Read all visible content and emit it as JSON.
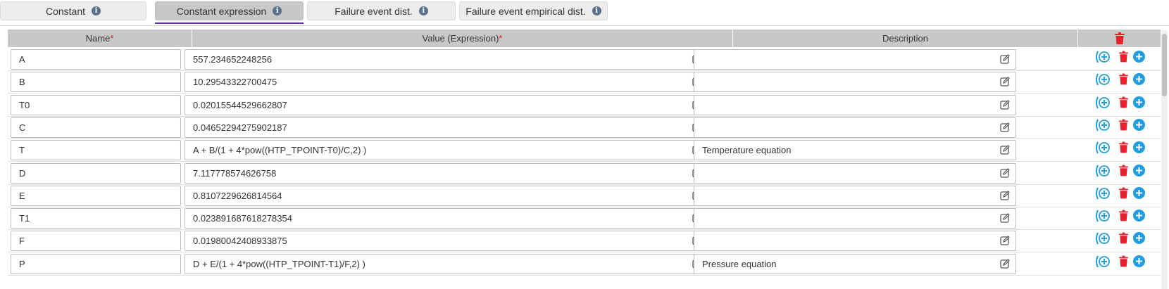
{
  "tabs": [
    {
      "label": "Constant",
      "active": false
    },
    {
      "label": "Constant expression",
      "active": true
    },
    {
      "label": "Failure event dist.",
      "active": false
    },
    {
      "label": "Failure event empirical dist.",
      "active": false
    }
  ],
  "table": {
    "headers": {
      "name": "Name",
      "value": "Value (Expression)",
      "description": "Description",
      "required_mark": "*"
    },
    "rows": [
      {
        "name": "A",
        "value": "557.234652248256",
        "description": ""
      },
      {
        "name": "B",
        "value": "10.29543322700475",
        "description": ""
      },
      {
        "name": "T0",
        "value": "0.02015544529662807",
        "description": ""
      },
      {
        "name": "C",
        "value": "0.04652294275902187",
        "description": ""
      },
      {
        "name": "T",
        "value": "A + B/(1 + 4*pow((HTP_TPOINT-T0)/C,2) )",
        "description": "Temperature equation"
      },
      {
        "name": "D",
        "value": "7.117778574626758",
        "description": ""
      },
      {
        "name": "E",
        "value": "0.8107229626814564",
        "description": ""
      },
      {
        "name": "T1",
        "value": "0.023891687618278354",
        "description": ""
      },
      {
        "name": "F",
        "value": "0.01980042408933875",
        "description": ""
      },
      {
        "name": "P",
        "value": "D + E/(1 + 4*pow((HTP_TPOINT-T1)/F,2) )",
        "description": "Pressure equation"
      }
    ]
  },
  "colors": {
    "accent_underline": "#5b2d90",
    "action_blue": "#1e9ee6",
    "delete_red": "#e8202c"
  },
  "icons": {
    "tab_info": "info-icon",
    "edit": "edit-icon",
    "insert_above": "insert-row-icon",
    "delete": "trash-icon",
    "add": "add-row-icon"
  }
}
